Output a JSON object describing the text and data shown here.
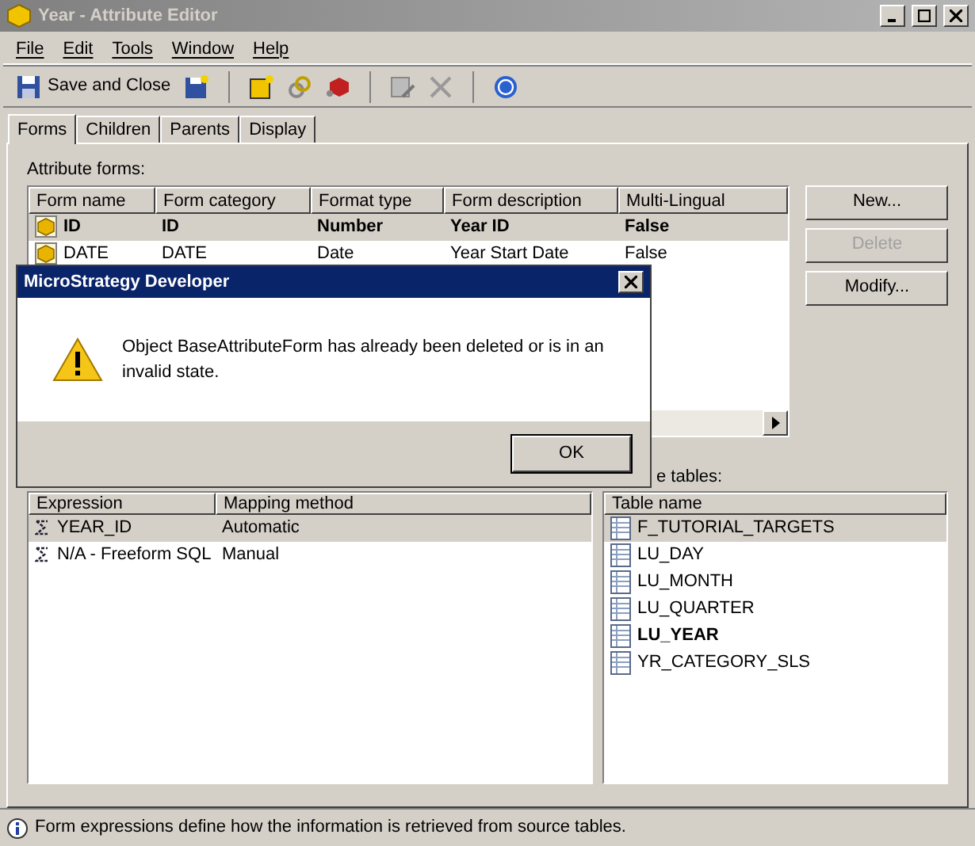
{
  "window": {
    "title": "Year - Attribute Editor"
  },
  "menu": [
    "File",
    "Edit",
    "Tools",
    "Window",
    "Help"
  ],
  "toolbar": {
    "save_label": "Save and Close"
  },
  "tabs": [
    {
      "label": "Forms",
      "selected": true
    },
    {
      "label": "Children",
      "selected": false
    },
    {
      "label": "Parents",
      "selected": false
    },
    {
      "label": "Display",
      "selected": false
    }
  ],
  "forms": {
    "label": "Attribute forms:",
    "columns": [
      "Form name",
      "Form category",
      "Format type",
      "Form description",
      "Multi-Lingual"
    ],
    "rows": [
      {
        "cells": [
          "ID",
          "ID",
          "Number",
          "Year ID",
          "False"
        ],
        "bold": true,
        "selected": true
      },
      {
        "cells": [
          "DATE",
          "DATE",
          "Date",
          "Year Start Date",
          "False"
        ],
        "bold": false,
        "selected": false
      }
    ]
  },
  "form_buttons": [
    {
      "label": "New...",
      "disabled": false
    },
    {
      "label": "Delete",
      "disabled": true
    },
    {
      "label": "Modify...",
      "disabled": false
    }
  ],
  "expressions": {
    "columns": [
      "Expression",
      "Mapping method"
    ],
    "rows": [
      {
        "cells": [
          "YEAR_ID",
          "Automatic"
        ],
        "selected": true
      },
      {
        "cells": [
          "N/A - Freeform SQL",
          "Manual"
        ],
        "selected": false
      }
    ]
  },
  "source_tables": {
    "label": "e tables:",
    "column": "Table name",
    "rows": [
      {
        "name": "F_TUTORIAL_TARGETS",
        "selected": true,
        "bold": false
      },
      {
        "name": "LU_DAY",
        "selected": false,
        "bold": false
      },
      {
        "name": "LU_MONTH",
        "selected": false,
        "bold": false
      },
      {
        "name": "LU_QUARTER",
        "selected": false,
        "bold": false
      },
      {
        "name": "LU_YEAR",
        "selected": false,
        "bold": true
      },
      {
        "name": "YR_CATEGORY_SLS",
        "selected": false,
        "bold": false
      }
    ]
  },
  "status_bar": "Form expressions define how the information is retrieved from source tables.",
  "dialog": {
    "title": "MicroStrategy Developer",
    "message": "Object BaseAttributeForm has already been deleted or is in an invalid state.",
    "button": "OK"
  }
}
